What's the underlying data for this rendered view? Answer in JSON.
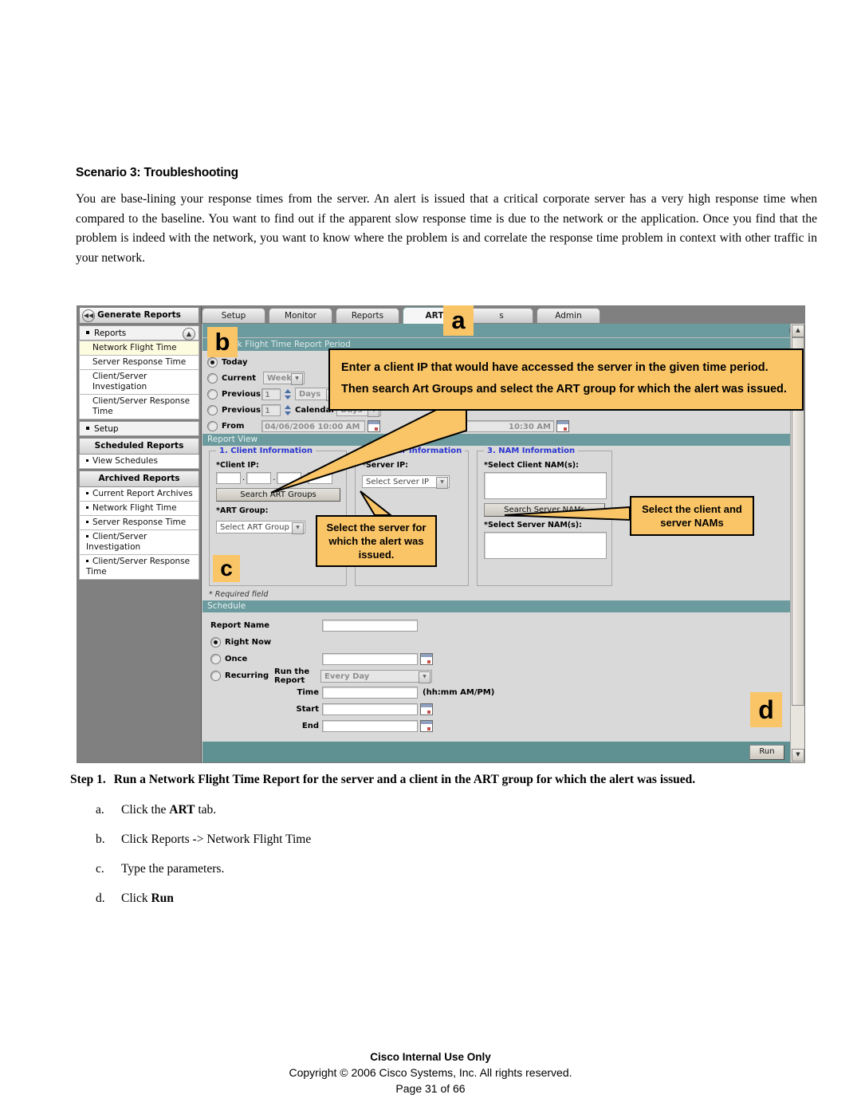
{
  "document": {
    "heading": "Scenario 3: Troubleshooting",
    "paragraph": "You are base-lining your response times from the server. An alert is issued that a critical corporate server has a very high response time when compared to the baseline. You want to find out if the apparent slow response time is due to the network or the application. Once you find that the problem is indeed with the network, you want to know where the problem is and correlate the response time problem in context with other traffic in your network.",
    "step": {
      "number": "Step 1.",
      "text": "Run a Network Flight Time Report for the server and a client in the ART group for which the alert was issued."
    },
    "substeps": [
      {
        "label": "a.",
        "pre": "Click the ",
        "bold": "ART",
        "post": " tab."
      },
      {
        "label": "b.",
        "pre": "Click Reports -> Network Flight Time",
        "bold": "",
        "post": ""
      },
      {
        "label": "c.",
        "pre": "Type the parameters.",
        "bold": "",
        "post": ""
      },
      {
        "label": "d.",
        "pre": "Click ",
        "bold": "Run",
        "post": ""
      }
    ]
  },
  "footer": {
    "line1": "Cisco Internal Use Only",
    "line2": "Copyright © 2006 Cisco Systems, Inc. All rights reserved.",
    "line3": "Page 31 of 66"
  },
  "app": {
    "tabs": [
      {
        "label": "Setup",
        "active": false
      },
      {
        "label": "Monitor",
        "active": false
      },
      {
        "label": "Reports",
        "active": false
      },
      {
        "label": "ART",
        "active": true
      },
      {
        "label": "s",
        "active": false
      },
      {
        "label": "Admin",
        "active": false
      }
    ],
    "sidebar": {
      "title": "Generate Reports",
      "collapse_icon": "◀◀",
      "groups": [
        {
          "label": "Reports",
          "toggle_icon": "▲",
          "items": [
            {
              "label": "Network Flight Time",
              "selected": true
            },
            {
              "label": "Server Response Time",
              "selected": false
            },
            {
              "label": "Client/Server Investigation",
              "selected": false
            },
            {
              "label": "Client/Server Response Time",
              "selected": false
            }
          ]
        }
      ],
      "setup_label": "Setup",
      "scheduled_title": "Scheduled Reports",
      "scheduled_items": [
        "View Schedules"
      ],
      "archived_title": "Archived Reports",
      "archived_items": [
        "Current Report Archives",
        "Network Flight Time",
        "Server Response Time",
        "Client/Server Investigation",
        "Client/Server Response Time"
      ]
    },
    "report_period": {
      "panel_title": "Network Flight Time Report Period",
      "collapse_icon": "▲",
      "options": [
        {
          "id": "today",
          "label": "Today",
          "selected": true
        },
        {
          "id": "current",
          "label": "Current",
          "selected": false,
          "select_value": "Week"
        },
        {
          "id": "previous_n",
          "label": "Previous",
          "selected": false,
          "count": "1",
          "select_value": "Days"
        },
        {
          "id": "previous_cal",
          "label": "Previous",
          "selected": false,
          "count": "1",
          "mid_label": "Calendar",
          "select_value": "Days"
        },
        {
          "id": "from",
          "label": "From",
          "selected": false,
          "from_value": "04/06/2006 10:00 AM",
          "to_value": "10:30 AM"
        }
      ]
    },
    "report_view": {
      "bar_title": "Report View",
      "client": {
        "legend": "1. Client Information",
        "ip_label": "*Client IP:",
        "ip_values": [
          "",
          "",
          "",
          ""
        ],
        "search_button": "Search ART Groups",
        "art_group_label": "*ART Group:",
        "art_group_value": "Select ART Group"
      },
      "server": {
        "legend": "2. Server Information",
        "ip_label": "*Server IP:",
        "ip_value": "Select Server IP"
      },
      "nam": {
        "legend": "3. NAM Information",
        "client_nam_label": "*Select Client NAM(s):",
        "search_button": "Search Server NAMs",
        "server_nam_label": "*Select Server NAM(s):"
      },
      "required_note": "* Required field"
    },
    "schedule": {
      "bar_title": "Schedule",
      "report_name_label": "Report Name",
      "report_name_value": "",
      "options": [
        {
          "label": "Right Now",
          "selected": true
        },
        {
          "label": "Once",
          "selected": false
        },
        {
          "label": "Recurring",
          "selected": false
        }
      ],
      "run_the_report_label": "Run the Report",
      "recurrence_value": "Every Day",
      "time_label": "Time",
      "time_hint": "(hh:mm AM/PM)",
      "start_label": "Start",
      "end_label": "End"
    },
    "run_button": "Run",
    "scroll_up_icon": "▲",
    "scroll_down_icon": "▼"
  },
  "callouts": {
    "a": "a",
    "b": "b",
    "c": "c",
    "d": "d",
    "client_ip": "Enter a client IP that would have accessed the server in the given time period. Then search Art Groups and select the ART group for which the alert was issued.",
    "server": "Select the server for which the alert was issued.",
    "nam": "Select the client and server NAMs"
  },
  "colors": {
    "teal": "#6b9b9e",
    "callout_orange": "#fac567",
    "selected_item": "#fefce0",
    "legend_blue": "#2a35cf",
    "sidebar_gray": "#808080"
  }
}
